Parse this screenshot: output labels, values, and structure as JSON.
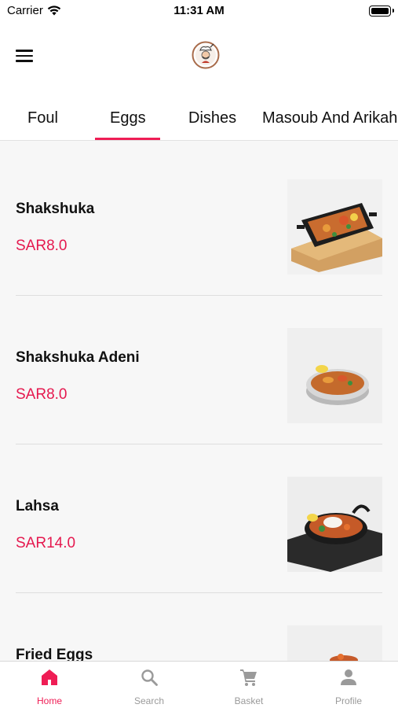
{
  "status_bar": {
    "carrier": "Carrier",
    "time": "11:31 AM"
  },
  "header": {
    "menu_icon": "hamburger-menu-icon",
    "logo_icon": "chef-logo-icon"
  },
  "tabs": [
    {
      "label": "Foul",
      "active": false
    },
    {
      "label": "Eggs",
      "active": true
    },
    {
      "label": "Dishes",
      "active": false
    },
    {
      "label": "Masoub And Arikah",
      "active": false
    }
  ],
  "items": [
    {
      "name": "Shakshuka",
      "price": "SAR8.0"
    },
    {
      "name": "Shakshuka Adeni",
      "price": "SAR8.0"
    },
    {
      "name": "Lahsa",
      "price": "SAR14.0"
    },
    {
      "name": "Fried Eggs",
      "price": ""
    }
  ],
  "bottom_nav": [
    {
      "label": "Home",
      "icon": "home-icon",
      "active": true
    },
    {
      "label": "Search",
      "icon": "search-icon",
      "active": false
    },
    {
      "label": "Basket",
      "icon": "cart-icon",
      "active": false
    },
    {
      "label": "Profile",
      "icon": "profile-icon",
      "active": false
    }
  ],
  "colors": {
    "accent": "#ef1d55",
    "price": "#e5194f",
    "inactive": "#9a9a9a"
  }
}
